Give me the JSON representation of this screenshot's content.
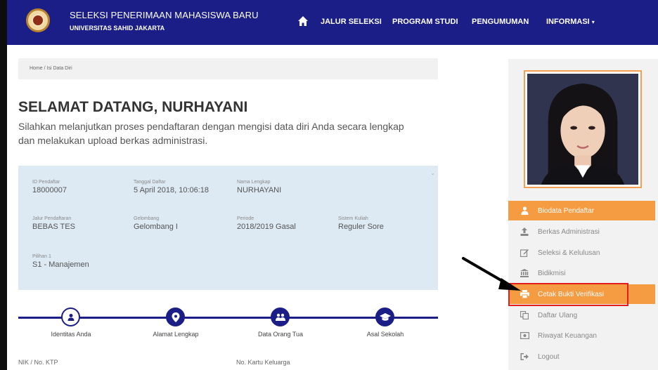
{
  "header": {
    "title": "SELEKSI PENERIMAAN MAHASISWA BARU",
    "subtitle": "UNIVERSITAS SAHID JAKARTA",
    "nav": [
      {
        "label": "JALUR SELEKSI"
      },
      {
        "label": "PROGRAM STUDI"
      },
      {
        "label": "PENGUMUMAN"
      },
      {
        "label": "INFORMASI"
      }
    ]
  },
  "breadcrumb": "Home / Isi Data Diri",
  "welcome": "SELAMAT DATANG, NURHAYANI",
  "intro": "Silahkan melanjutkan proses pendaftaran dengan mengisi data diri Anda secara lengkap dan melakukan upload berkas administrasi.",
  "info": {
    "id_label": "ID Pendaftar",
    "id_value": "18000007",
    "date_label": "Tanggal Daftar",
    "date_value": "5 April 2018, 10:06:18",
    "name_label": "Nama Lengkap",
    "name_value": "NURHAYANI",
    "jalur_label": "Jalur Pendaftaran",
    "jalur_value": "BEBAS TES",
    "gel_label": "Gelombang",
    "gel_value": "Gelombang I",
    "periode_label": "Periode",
    "periode_value": "2018/2019 Gasal",
    "sistem_label": "Sistem Kuliah",
    "sistem_value": "Reguler Sore",
    "pilihan_label": "Pilihan 1",
    "pilihan_value": "S1 - Manajemen"
  },
  "steps": [
    {
      "label": "Identitas Anda",
      "icon": "user-icon"
    },
    {
      "label": "Alamat Lengkap",
      "icon": "map-marker-icon"
    },
    {
      "label": "Data Orang Tua",
      "icon": "users-icon"
    },
    {
      "label": "Asal Sekolah",
      "icon": "graduation-cap-icon"
    }
  ],
  "form_labels": {
    "nik": "NIK / No. KTP",
    "kk": "No. Kartu Keluarga"
  },
  "sidebar": {
    "menu": [
      {
        "label": "Biodata Pendaftar",
        "icon": "user-icon",
        "state": "active"
      },
      {
        "label": "Berkas Administrasi",
        "icon": "upload-icon",
        "state": "normal"
      },
      {
        "label": "Seleksi & Kelulusan",
        "icon": "edit-icon",
        "state": "normal"
      },
      {
        "label": "Bidikmisi",
        "icon": "bank-icon",
        "state": "normal"
      },
      {
        "label": "Cetak Bukti Verifikasi",
        "icon": "print-icon",
        "state": "highlight"
      },
      {
        "label": "Daftar Ulang",
        "icon": "copy-icon",
        "state": "normal"
      },
      {
        "label": "Riwayat Keuangan",
        "icon": "money-icon",
        "state": "normal"
      },
      {
        "label": "Logout",
        "icon": "logout-icon",
        "state": "normal"
      }
    ]
  },
  "colors": {
    "navbar": "#1b1e86",
    "accent_orange": "#f59b42",
    "annotation_red": "#e21f1f",
    "panel_blue": "#dde9f3"
  }
}
